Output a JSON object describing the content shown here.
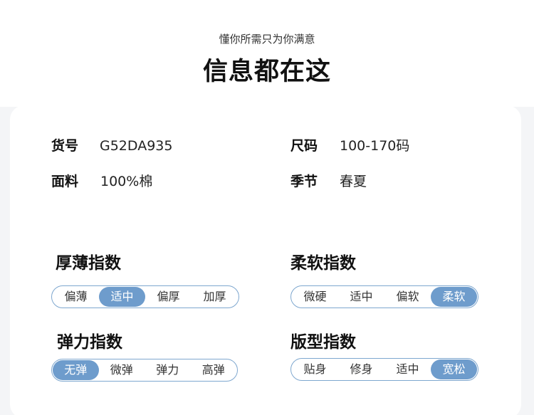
{
  "header": {
    "subtitle": "懂你所需只为你满意",
    "title": "信息都在这"
  },
  "info": {
    "item_no_label": "货号",
    "item_no_value": "G52DA935",
    "size_label": "尺码",
    "size_value": "100-170码",
    "fabric_label": "面料",
    "fabric_value": "100%棉",
    "season_label": "季节",
    "season_value": "春夏"
  },
  "indices": {
    "thickness": {
      "title": "厚薄指数",
      "options": [
        "偏薄",
        "适中",
        "偏厚",
        "加厚"
      ],
      "selected": 1
    },
    "softness": {
      "title": "柔软指数",
      "options": [
        "微硬",
        "适中",
        "偏软",
        "柔软"
      ],
      "selected": 3
    },
    "elasticity": {
      "title": "弹力指数",
      "options": [
        "无弹",
        "微弹",
        "弹力",
        "高弹"
      ],
      "selected": 0
    },
    "fit": {
      "title": "版型指数",
      "options": [
        "贴身",
        "修身",
        "适中",
        "宽松"
      ],
      "selected": 3
    }
  },
  "colors": {
    "accent": "#6e9ccc",
    "border": "#7ea7cf"
  }
}
